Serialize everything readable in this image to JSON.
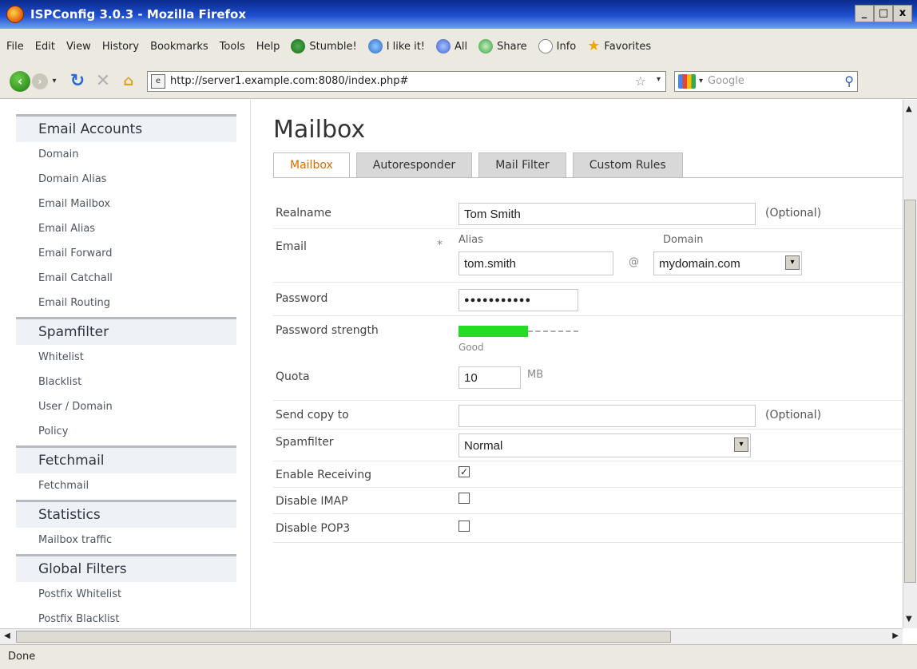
{
  "window": {
    "title": "ISPConfig 3.0.3 - Mozilla Firefox"
  },
  "window_buttons": [
    "_",
    "□",
    "x"
  ],
  "menu": {
    "items": [
      "File",
      "Edit",
      "View",
      "History",
      "Bookmarks",
      "Tools",
      "Help"
    ],
    "toolbar": [
      {
        "label": "Stumble!",
        "icon": "stumbleupon-icon"
      },
      {
        "label": "I like it!",
        "icon": "thumbs-up-icon"
      },
      {
        "label": "All",
        "icon": "heart-icon"
      },
      {
        "label": "Share",
        "icon": "share-icon"
      },
      {
        "label": "Info",
        "icon": "info-bubble-icon"
      },
      {
        "label": "Favorites",
        "icon": "star-icon"
      }
    ]
  },
  "nav": {
    "url": "http://server1.example.com:8080/index.php#",
    "search_placeholder": "Google"
  },
  "sidebar": {
    "sections": [
      {
        "title": "Email Accounts",
        "items": [
          "Domain",
          "Domain Alias",
          "Email Mailbox",
          "Email Alias",
          "Email Forward",
          "Email Catchall",
          "Email Routing"
        ]
      },
      {
        "title": "Spamfilter",
        "items": [
          "Whitelist",
          "Blacklist",
          "User / Domain",
          "Policy"
        ]
      },
      {
        "title": "Fetchmail",
        "items": [
          "Fetchmail"
        ]
      },
      {
        "title": "Statistics",
        "items": [
          "Mailbox traffic"
        ]
      },
      {
        "title": "Global Filters",
        "items": [
          "Postfix Whitelist",
          "Postfix Blacklist"
        ]
      }
    ]
  },
  "main": {
    "title": "Mailbox",
    "tabs": [
      {
        "label": "Mailbox",
        "active": true
      },
      {
        "label": "Autoresponder",
        "active": false
      },
      {
        "label": "Mail Filter",
        "active": false
      },
      {
        "label": "Custom Rules",
        "active": false
      }
    ],
    "form": {
      "realname_label": "Realname",
      "realname_value": "Tom Smith",
      "optional_label": "(Optional)",
      "email_label": "Email",
      "required_mark": "*",
      "alias_label": "Alias",
      "alias_value": "tom.smith",
      "at_sign": "@",
      "domain_label": "Domain",
      "domain_value": "mydomain.com",
      "password_label": "Password",
      "password_value": "●●●●●●●●●●●",
      "strength_label": "Password strength",
      "strength_text": "Good",
      "strength_fraction": 0.58,
      "quota_label": "Quota",
      "quota_value": "10",
      "quota_unit": "MB",
      "sendcopy_label": "Send copy to",
      "sendcopy_value": "",
      "sendcopy_optional": "(Optional)",
      "spamfilter_label": "Spamfilter",
      "spamfilter_value": "Normal",
      "enable_receiving_label": "Enable Receiving",
      "enable_receiving_checked": true,
      "disable_imap_label": "Disable IMAP",
      "disable_imap_checked": false,
      "disable_pop3_label": "Disable POP3",
      "disable_pop3_checked": false
    }
  },
  "status": {
    "text": "Done"
  },
  "colors": {
    "active_tab": "#e06a00",
    "strength_bar": "#22dd22",
    "title_bar": "#0a2a8c"
  }
}
